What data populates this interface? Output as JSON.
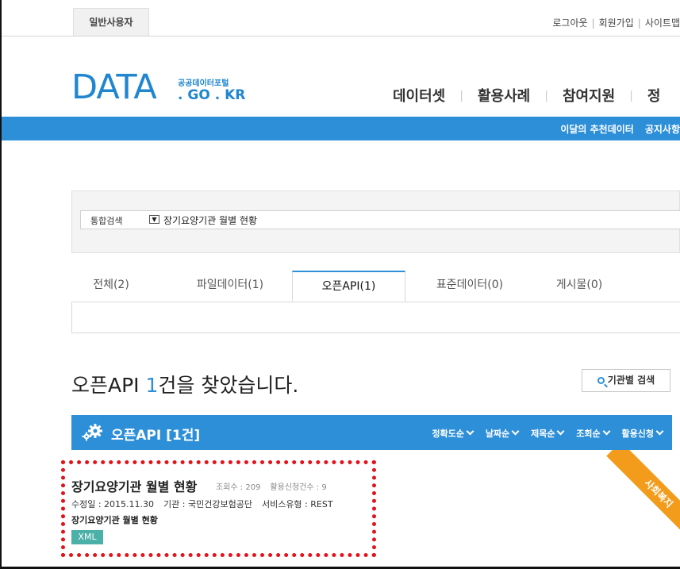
{
  "topbar": {
    "user_tab": "일반사용자",
    "links": [
      "로그아웃",
      "회원가입",
      "사이트맵"
    ]
  },
  "logo": {
    "main": "DATA",
    "kr": "공공데이터포털",
    "domain": ". GO . KR"
  },
  "nav": {
    "items": [
      "데이터셋",
      "활용사례",
      "참여지원",
      "정"
    ]
  },
  "subbar": {
    "links": [
      "이달의 추천데이터",
      "공지사항"
    ]
  },
  "search": {
    "scope": "통합검색",
    "query": "장기요양기관 월별 현황"
  },
  "tabs": [
    {
      "label": "전체(2)"
    },
    {
      "label": "파일데이터(1)"
    },
    {
      "label": "오픈API(1)"
    },
    {
      "label": "표준데이터(0)"
    },
    {
      "label": "게시물(0)"
    }
  ],
  "results": {
    "heading_prefix": "오픈API ",
    "heading_count": "1",
    "heading_suffix": "건을 찾았습니다.",
    "org_search_label": "기관별 검색",
    "header_title": "오픈API [1건]",
    "sorts": [
      "정확도순",
      "날짜순",
      "제목순",
      "조회순",
      "활용신청"
    ]
  },
  "item": {
    "title": "장기요양기관 월별 현황",
    "views": "조회수 : 209",
    "requests": "활용신청건수 : 9",
    "modified": "수정일 : 2015.11.30",
    "org": "기관 : 국민건강보험공단",
    "service_type": "서비스유형 : REST",
    "description": "장기요양기관 월별 현황",
    "format": "XML",
    "category": "사회복지"
  },
  "colors": {
    "brand_blue": "#2d8fd8",
    "badge_teal": "#4bb0a8",
    "ribbon_orange": "#f39c1c",
    "highlight_red": "#e4121b"
  }
}
